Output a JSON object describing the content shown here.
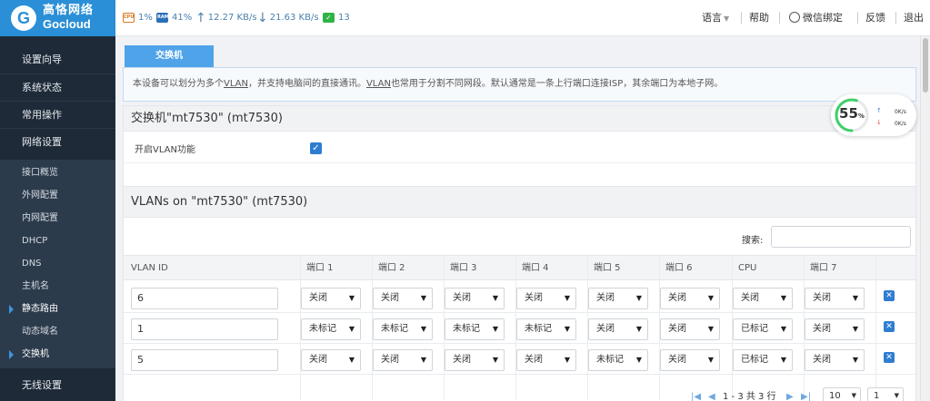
{
  "brand": {
    "name_cn": "高恪网络",
    "name_en": "Gocloud"
  },
  "status_bar": {
    "cpu_label": "CPU",
    "cpu": "1%",
    "ram_label": "RAM",
    "ram": "41%",
    "upload": "12.27 KB/s",
    "download": "21.63 KB/s",
    "wechat_count": "13"
  },
  "top_links": {
    "language": "语言",
    "help": "帮助",
    "wechat_bind": "微信绑定",
    "feedback": "反馈",
    "logout": "退出"
  },
  "sidebar": {
    "main_items": [
      "设置向导",
      "系统状态",
      "常用操作",
      "网络设置"
    ],
    "sub_items": [
      "接口概览",
      "外网配置",
      "内网配置",
      "DHCP",
      "DNS",
      "主机名",
      "静态路由",
      "动态域名",
      "交换机"
    ],
    "bottom_item": "无线设置"
  },
  "page": {
    "tab": "交换机",
    "description_parts": [
      "本设备可以划分为多个",
      "VLAN",
      "，并支持电脑间的直接通讯。",
      "VLAN",
      "也常用于分割不同网段。默认通常是一条上行端口连接ISP，其余端口为本地子网。"
    ]
  },
  "switch_panel": {
    "title": "交换机\"mt7530\" (mt7530)",
    "enable_vlan_label": "开启VLAN功能",
    "enable_vlan": true
  },
  "vlan_panel": {
    "title": "VLANs on \"mt7530\" (mt7530)",
    "search_label": "搜索:",
    "search_value": "",
    "columns": [
      "VLAN ID",
      "端口 1",
      "端口 2",
      "端口 3",
      "端口 4",
      "端口 5",
      "端口 6",
      "CPU",
      "端口 7"
    ],
    "rows": [
      {
        "vlan_id": "6",
        "ports": [
          "关闭",
          "关闭",
          "关闭",
          "关闭",
          "关闭",
          "关闭",
          "关闭",
          "关闭"
        ]
      },
      {
        "vlan_id": "1",
        "ports": [
          "未标记",
          "未标记",
          "未标记",
          "未标记",
          "关闭",
          "关闭",
          "已标记",
          "关闭"
        ]
      },
      {
        "vlan_id": "5",
        "ports": [
          "关闭",
          "关闭",
          "关闭",
          "关闭",
          "未标记",
          "关闭",
          "已标记",
          "关闭"
        ]
      }
    ],
    "delete_glyph": "✕",
    "pagination": {
      "summary": "1 - 3 共 3 行",
      "page_size": "10",
      "page": "1"
    }
  },
  "gauge": {
    "percent": "55",
    "percent_sign": "%",
    "up": "0K/s",
    "down": "0K/s"
  },
  "colors": {
    "brand": "#2a8fd6",
    "sidebar": "#1e2a38",
    "accent": "#4fa3e8",
    "gauge_green": "#3fcf6a"
  }
}
